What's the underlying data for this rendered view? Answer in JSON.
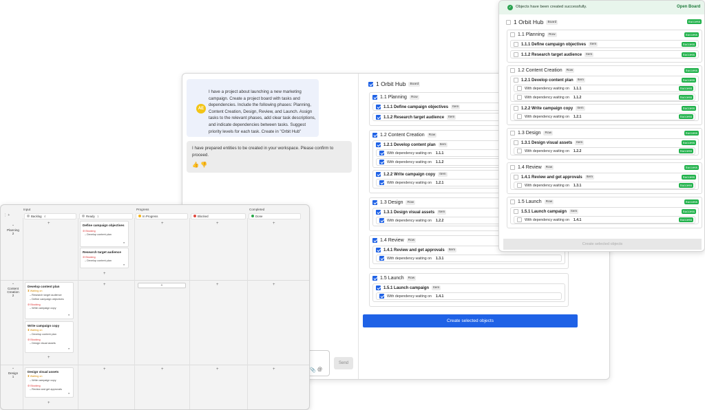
{
  "chat": {
    "avatar_initials": "AE",
    "user_message": "I have a project about launching a new marketing campaign. Create a project board with tasks and dependencies. Include the following phases: Planning, Content Creation, Design, Review, and Launch. Assign tasks to the relevant phases, add clear task descriptions, and indicate dependencies between tasks. Suggest priority levels for each task. Create in \"Orbit Hub\"",
    "bot_message": "I have prepared entities to be created in your workspace. Please confirm to proceed.",
    "thumb_up": "👍",
    "thumb_down": "👎",
    "send_label": "Send",
    "attach_icon": "📎",
    "mention_icon": "@"
  },
  "tree": {
    "board": {
      "num": "1",
      "name": "Orbit Hub",
      "tag": "Board"
    },
    "rows": [
      {
        "num": "1.1",
        "name": "Planning",
        "tag": "Row",
        "items": [
          {
            "num": "1.1.1",
            "name": "Define campaign objectives",
            "tag": "Item",
            "deps": []
          },
          {
            "num": "1.1.2",
            "name": "Research target audience",
            "tag": "Item",
            "deps": []
          }
        ]
      },
      {
        "num": "1.2",
        "name": "Content Creation",
        "tag": "Row",
        "items": [
          {
            "num": "1.2.1",
            "name": "Develop content plan",
            "tag": "Item",
            "deps": [
              "1.1.1",
              "1.1.2"
            ]
          },
          {
            "num": "1.2.2",
            "name": "Write campaign copy",
            "tag": "Item",
            "deps": [
              "1.2.1"
            ]
          }
        ]
      },
      {
        "num": "1.3",
        "name": "Design",
        "tag": "Row",
        "items": [
          {
            "num": "1.3.1",
            "name": "Design visual assets",
            "tag": "Item",
            "deps": [
              "1.2.2"
            ]
          }
        ]
      },
      {
        "num": "1.4",
        "name": "Review",
        "tag": "Row",
        "items": [
          {
            "num": "1.4.1",
            "name": "Review and get approvals",
            "tag": "Item",
            "deps": [
              "1.3.1"
            ]
          }
        ]
      },
      {
        "num": "1.5",
        "name": "Launch",
        "tag": "Row",
        "items": [
          {
            "num": "1.5.1",
            "name": "Launch campaign",
            "tag": "Item",
            "deps": [
              "1.4.1"
            ]
          }
        ]
      }
    ],
    "dep_label": "With dependency waiting on"
  },
  "create_button": "Create selected objects",
  "result": {
    "banner": "Objects have been created successfully.",
    "open_board": "Open Board",
    "success": "Success",
    "disabled_button": "Create selected objects"
  },
  "board": {
    "groups": [
      "Input",
      "Progress",
      "Completed"
    ],
    "columns": [
      {
        "label": "Backlog",
        "count": "4",
        "dot": "#bdbdbd"
      },
      {
        "label": "Ready",
        "count": "1",
        "dot": "#bdbdbd"
      },
      {
        "label": "In Progress",
        "count": "",
        "dot": "#f5b316"
      },
      {
        "label": "Blocked",
        "count": "",
        "dot": "#e0463c"
      },
      {
        "label": "Done",
        "count": "",
        "dot": "#29a84a"
      }
    ],
    "lanes": [
      {
        "name": "Planning",
        "count": "2"
      },
      {
        "name": "Content Creation",
        "count": "2"
      },
      {
        "name": "Design",
        "count": "1"
      }
    ],
    "waiting_on": "Waiting on",
    "blocking": "Blocking",
    "cards": {
      "define": {
        "title": "Define campaign objectives",
        "blocking": "Blocking",
        "lines": [
          "Develop content plan"
        ]
      },
      "research": {
        "title": "Research target audience",
        "blocking": "Blocking",
        "lines": [
          "Develop content plan"
        ]
      },
      "develop": {
        "title": "Develop content plan",
        "waiting": "Waiting on",
        "wlines": [
          "Research target audience",
          "Define campaign objectives"
        ],
        "blocking": "Blocking",
        "blines": [
          "Write campaign copy"
        ]
      },
      "write": {
        "title": "Write campaign copy",
        "waiting": "Waiting on",
        "wlines": [
          "Develop content plan"
        ],
        "blocking": "Blocking",
        "blines": [
          "Design visual assets"
        ]
      },
      "designv": {
        "title": "Design visual assets",
        "waiting": "Waiting on",
        "wlines": [
          "Write campaign copy"
        ],
        "blocking": "Blocking",
        "blines": [
          "Review and get approvals"
        ]
      }
    }
  }
}
